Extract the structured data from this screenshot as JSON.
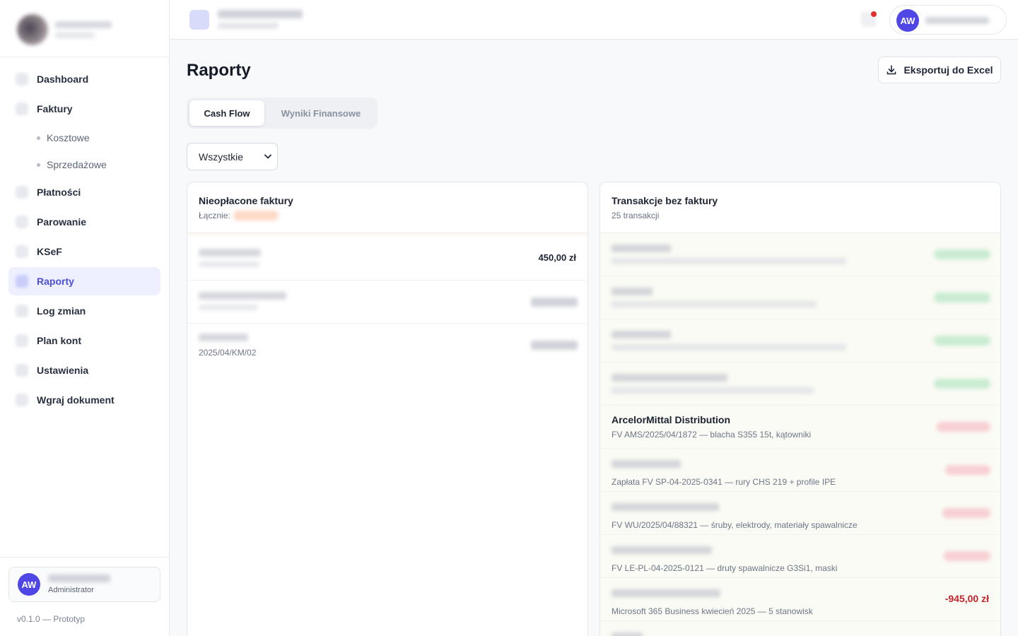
{
  "sidebar": {
    "items": [
      {
        "label": "Dashboard"
      },
      {
        "label": "Faktury"
      },
      {
        "label": "Kosztowe"
      },
      {
        "label": "Sprzedażowe"
      },
      {
        "label": "Płatności"
      },
      {
        "label": "Parowanie"
      },
      {
        "label": "KSeF"
      },
      {
        "label": "Raporty"
      },
      {
        "label": "Log zmian"
      },
      {
        "label": "Plan kont"
      },
      {
        "label": "Ustawienia"
      },
      {
        "label": "Wgraj dokument"
      }
    ],
    "active": "Raporty",
    "user": {
      "initials": "AW",
      "role": "Administrator"
    },
    "version": "v0.1.0 — Prototyp"
  },
  "topbar": {
    "user_initials": "AW"
  },
  "page": {
    "title": "Raporty",
    "export_label": "Eksportuj do Excel",
    "tabs": [
      {
        "label": "Cash Flow",
        "active": true
      },
      {
        "label": "Wyniki Finansowe",
        "active": false
      }
    ],
    "filter_value": "Wszystkie"
  },
  "unpaid": {
    "title": "Nieopłacone faktury",
    "total_label": "Łącznie:",
    "rows": [
      {
        "amount": "450,00 zł"
      },
      {
        "sub": ""
      },
      {
        "sub": "2025/04/KM/02"
      }
    ]
  },
  "transactions": {
    "title": "Transakcje bez faktury",
    "count_label": "25 transakcji",
    "rows": [
      {
        "name": "ArcelorMittal Distribution",
        "desc": "FV AMS/2025/04/1872 — blacha S355 15t, kątowniki"
      },
      {
        "desc": "Zapłata FV SP-04-2025-0341 — rury CHS 219 + profile IPE"
      },
      {
        "desc": "FV WU/2025/04/88321 — śruby, elektrody, materiały spawalnicze"
      },
      {
        "desc": "FV LE-PL-04-2025-0121 — druty spawalnicze G3Si1, maski"
      },
      {
        "desc": "Microsoft 365 Business kwiecień 2025 — 5 stanowisk",
        "amount": "-945,00 zł"
      }
    ]
  },
  "colors": {
    "accent": "#5046e5",
    "active_nav_bg": "#eef0ff",
    "negative": "#c4242d",
    "notification": "#e0312f"
  }
}
